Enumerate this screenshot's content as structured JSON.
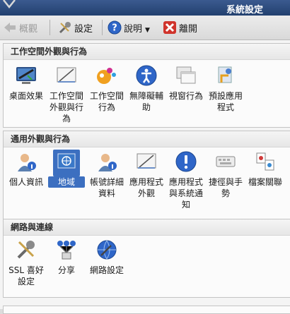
{
  "window": {
    "title": "系統設定"
  },
  "toolbar": {
    "back_label": "概觀",
    "config_label": "設定",
    "help_label": "說明",
    "quit_label": "離開"
  },
  "sections": [
    {
      "title": "工作空間外觀與行為",
      "items": [
        {
          "label": "桌面效果",
          "icon": "desktop-effects-icon"
        },
        {
          "label": "工作空間外觀與行為",
          "icon": "workspace-appearance-icon"
        },
        {
          "label": "工作空間行為",
          "icon": "workspace-behavior-icon"
        },
        {
          "label": "無障礙輔助",
          "icon": "accessibility-icon"
        },
        {
          "label": "視窗行為",
          "icon": "window-behavior-icon"
        },
        {
          "label": "預設應用程式",
          "icon": "default-applications-icon"
        }
      ]
    },
    {
      "title": "通用外觀與行為",
      "items": [
        {
          "label": "個人資訊",
          "icon": "personal-info-icon"
        },
        {
          "label": "地域",
          "icon": "locale-icon",
          "selected": true
        },
        {
          "label": "帳號詳細資料",
          "icon": "account-details-icon"
        },
        {
          "label": "應用程式外觀",
          "icon": "application-appearance-icon"
        },
        {
          "label": "應用程式與系統通知",
          "icon": "notifications-icon"
        },
        {
          "label": "捷徑與手勢",
          "icon": "shortcuts-icon"
        },
        {
          "label": "檔案關聯",
          "icon": "file-associations-icon"
        }
      ]
    },
    {
      "title": "網路與連線",
      "items": [
        {
          "label": "SSL 喜好設定",
          "icon": "ssl-icon"
        },
        {
          "label": "分享",
          "icon": "sharing-icon"
        },
        {
          "label": "網路設定",
          "icon": "network-settings-icon"
        }
      ]
    }
  ]
}
